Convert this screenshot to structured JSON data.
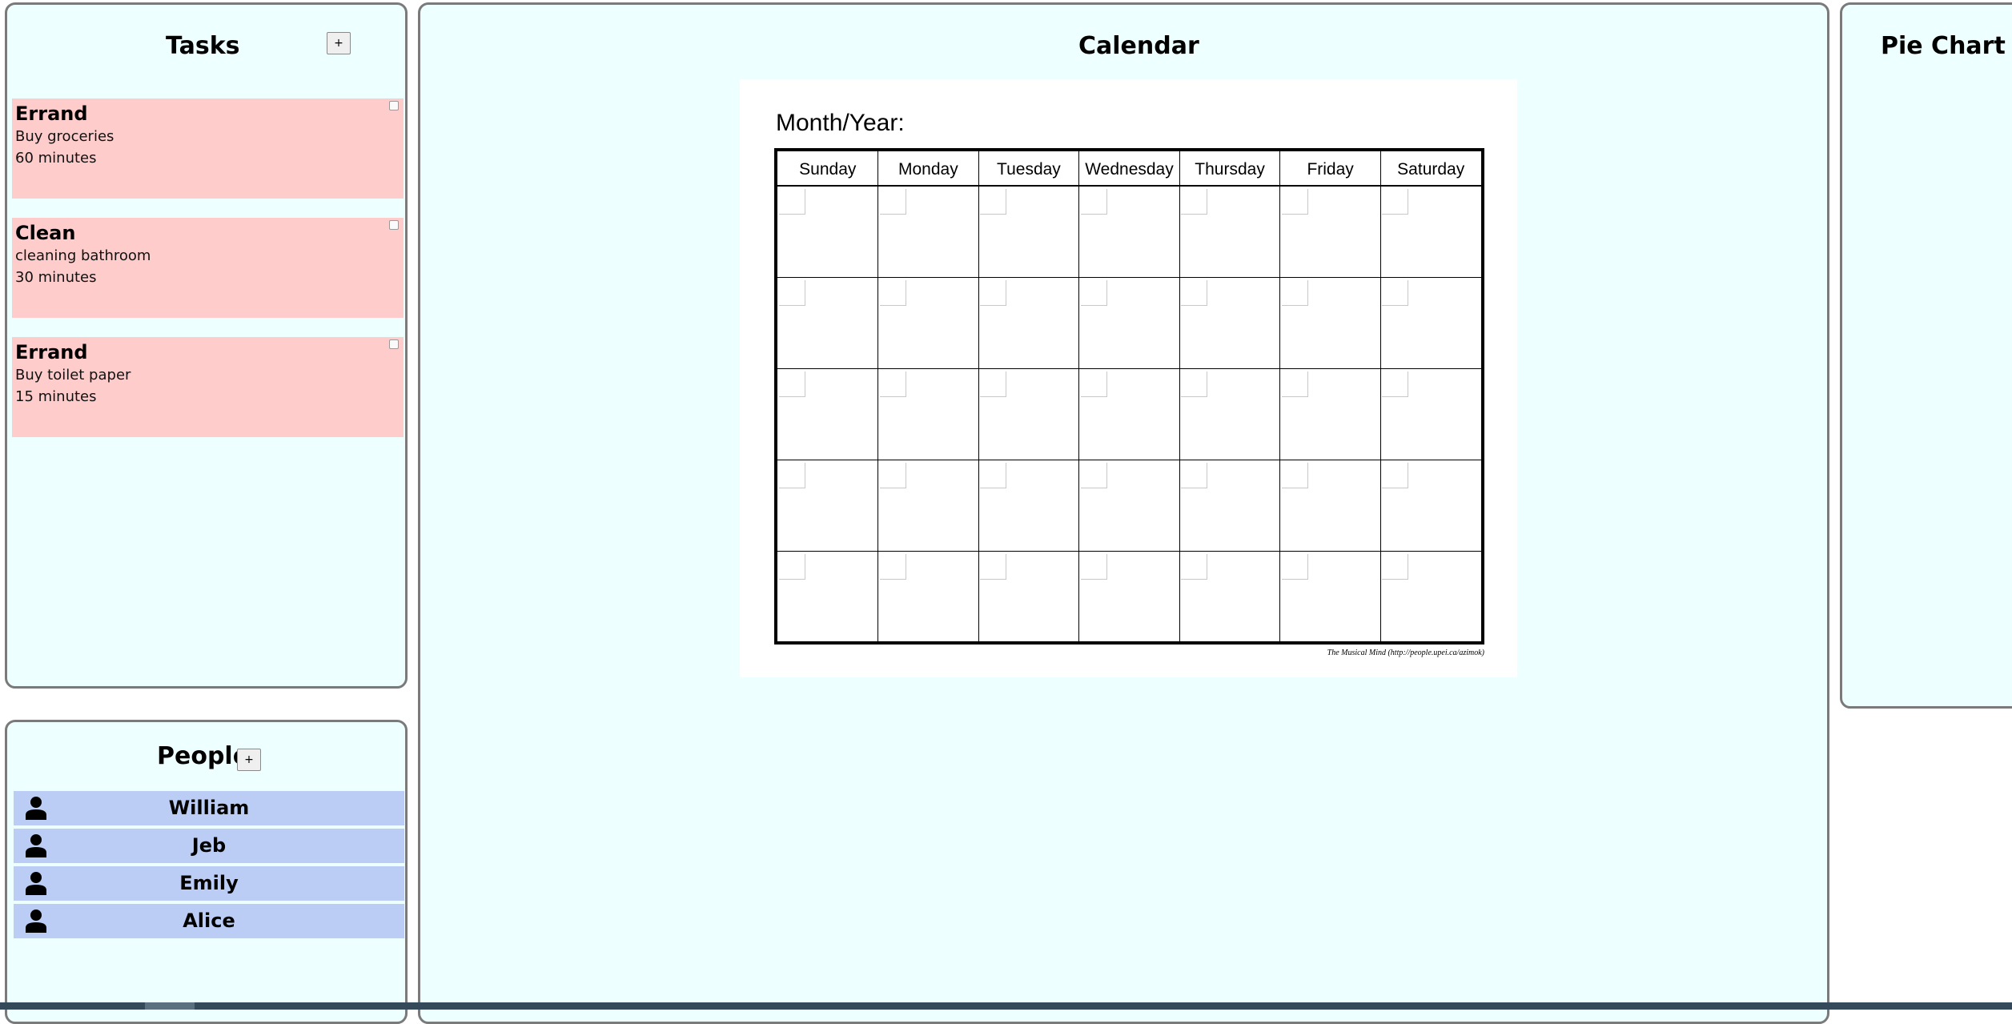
{
  "tasks_panel": {
    "title": "Tasks",
    "add_label": "+",
    "items": [
      {
        "type": "Errand",
        "description": "Buy groceries",
        "duration": "60 minutes",
        "color": "#ffcccc"
      },
      {
        "type": "Clean",
        "description": "cleaning bathroom",
        "duration": "30 minutes",
        "color": "#ffcccc"
      },
      {
        "type": "Errand",
        "description": "Buy toilet paper",
        "duration": "15 minutes",
        "color": "#ffcccc"
      }
    ]
  },
  "people_panel": {
    "title": "People",
    "add_label": "+",
    "people": [
      {
        "name": "William",
        "icon": "person-icon"
      },
      {
        "name": "Jeb",
        "icon": "person-icon"
      },
      {
        "name": "Emily",
        "icon": "person-icon"
      },
      {
        "name": "Alice",
        "icon": "person-icon"
      }
    ]
  },
  "calendar_panel": {
    "title": "Calendar",
    "month_year_label": "Month/Year:",
    "days": [
      "Sunday",
      "Monday",
      "Tuesday",
      "Wednesday",
      "Thursday",
      "Friday",
      "Saturday"
    ],
    "weeks": 5,
    "credit": "The Musical Mind  (http://people.upei.ca/azimok)"
  },
  "pie_panel": {
    "title": "Pie Chart"
  },
  "colors": {
    "panel_background": "#eeffff",
    "panel_border": "#7a7a7a",
    "task_card": "#ffcccc",
    "person_row": "#bbcdf5",
    "bottom_bar": "#34495a"
  }
}
